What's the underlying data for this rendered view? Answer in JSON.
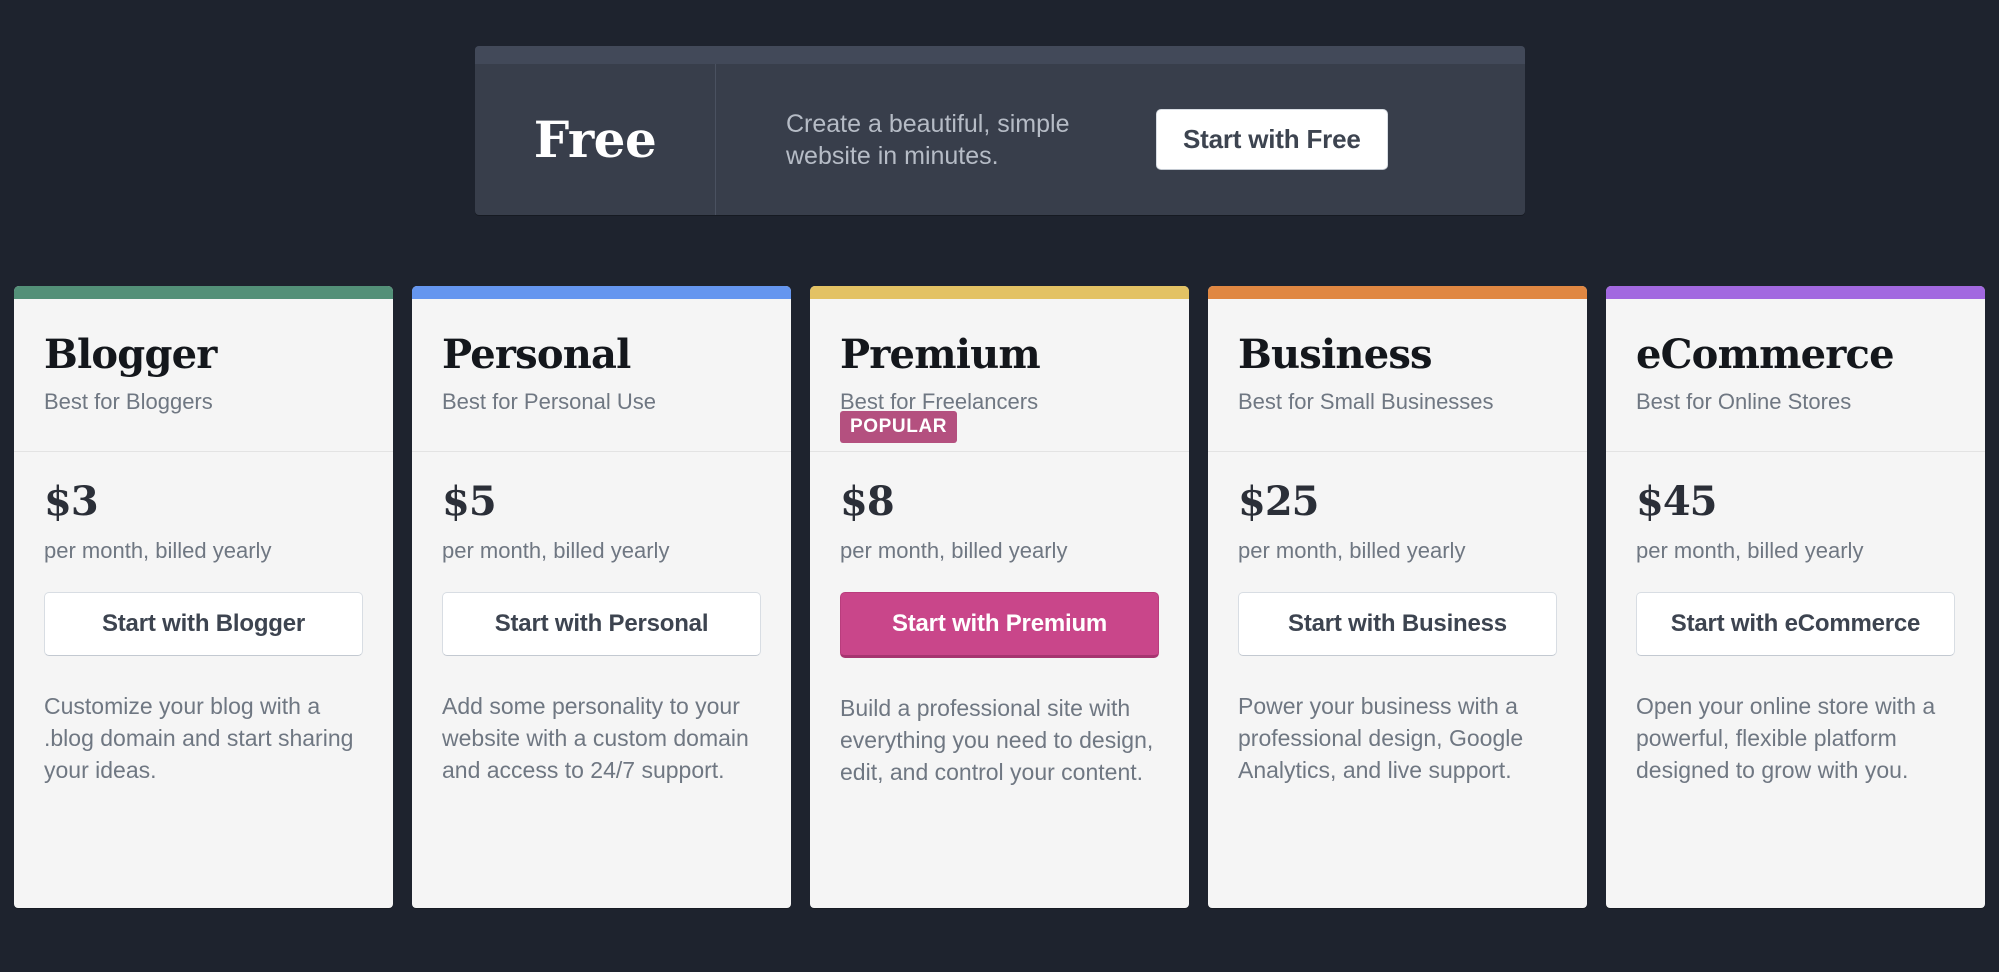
{
  "colors": {
    "page_background": "#1e232e",
    "banner_background": "#383e4b",
    "card_background": "#f5f5f5",
    "primary_button": "#c9468a",
    "badge": "#b4507f"
  },
  "banner": {
    "name": "Free",
    "description": "Create a beautiful, simple website in minutes.",
    "cta_label": "Start with Free"
  },
  "plans": [
    {
      "name": "Blogger",
      "tagline": "Best for Bloggers",
      "badge": "",
      "price": "$3",
      "period": "per month, billed yearly",
      "cta_label": "Start with Blogger",
      "description": "Customize your blog with a .blog domain and start sharing your ideas.",
      "accent_color": "#539078",
      "featured": false
    },
    {
      "name": "Personal",
      "tagline": "Best for Personal Use",
      "badge": "",
      "price": "$5",
      "period": "per month, billed yearly",
      "cta_label": "Start with Personal",
      "description": "Add some personality to your website with a custom domain and access to 24/7 support.",
      "accent_color": "#6596ef",
      "featured": false
    },
    {
      "name": "Premium",
      "tagline": "Best for Freelancers",
      "badge": "POPULAR",
      "price": "$8",
      "period": "per month, billed yearly",
      "cta_label": "Start with Premium",
      "description": "Build a professional site with everything you need to design, edit, and control your content.",
      "accent_color": "#e3c264",
      "featured": true
    },
    {
      "name": "Business",
      "tagline": "Best for Small Businesses",
      "badge": "",
      "price": "$25",
      "period": "per month, billed yearly",
      "cta_label": "Start with Business",
      "description": "Power your business with a professional design, Google Analytics, and live support.",
      "accent_color": "#e08742",
      "featured": false
    },
    {
      "name": "eCommerce",
      "tagline": "Best for Online Stores",
      "badge": "",
      "price": "$45",
      "period": "per month, billed yearly",
      "cta_label": "Start with eCommerce",
      "description": "Open your online store with a powerful, flexible platform designed to grow with you.",
      "accent_color": "#a268e0",
      "featured": false
    }
  ]
}
